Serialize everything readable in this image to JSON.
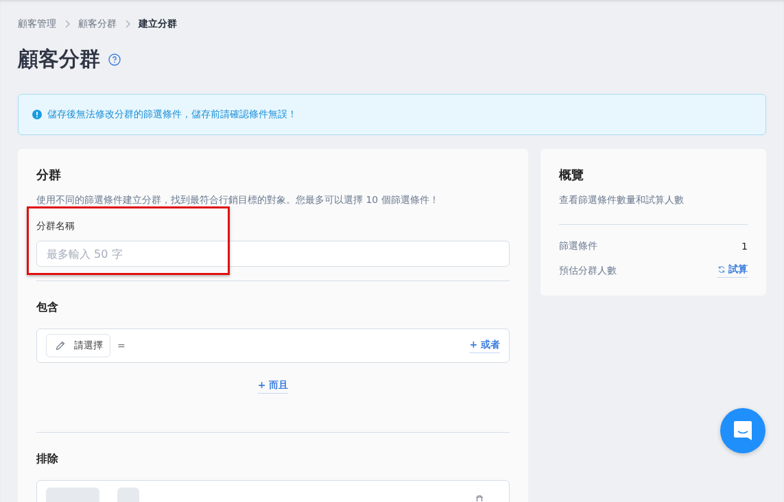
{
  "breadcrumb": [
    {
      "label": "顧客管理",
      "current": false
    },
    {
      "label": "顧客分群",
      "current": false
    },
    {
      "label": "建立分群",
      "current": true
    }
  ],
  "page_title": "顧客分群",
  "alert": {
    "text": "儲存後無法修改分群的篩選條件，儲存前請確認條件無誤！"
  },
  "segment": {
    "title": "分群",
    "description": "使用不同的篩選條件建立分群，找到最符合行銷目標的對象。您最多可以選擇 10 個篩選條件！",
    "name_label": "分群名稱",
    "name_placeholder": "最多輸入 50 字",
    "highlighted": true,
    "include": {
      "title": "包含",
      "select_label": "請選擇",
      "operator": "=",
      "or_label": "+ 或者",
      "and_label": "+ 而且"
    },
    "exclude": {
      "title": "排除"
    }
  },
  "overview": {
    "title": "概覽",
    "description": "查看篩選條件數量和試算人數",
    "rows": [
      {
        "kind": "value",
        "label": "篩選條件",
        "value": "1"
      },
      {
        "kind": "action",
        "label": "預估分群人數",
        "value": "試算"
      }
    ]
  }
}
